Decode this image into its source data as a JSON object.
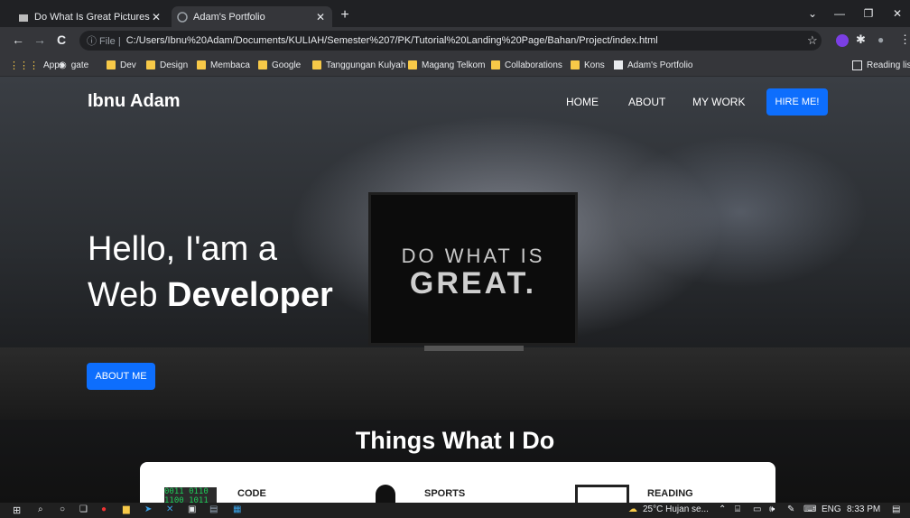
{
  "browser": {
    "tabs": [
      {
        "title": "Do What Is Great Pictures | Down",
        "active": false
      },
      {
        "title": "Adam's Portfolio",
        "active": true
      }
    ],
    "new_tab": "+",
    "window_controls": [
      "⌄",
      "—",
      "❐",
      "✕"
    ],
    "nav": {
      "back": "←",
      "forward": "→",
      "reload": "C"
    },
    "omnibox": {
      "security": "ⓘ File |",
      "url": "C:/Users/Ibnu%20Adam/Documents/KULIAH/Semester%207/PK/Tutorial%20Landing%20Page/Bahan/Project/index.html"
    },
    "bookmarks": [
      "Apps",
      "gate",
      "Dev",
      "Design",
      "Membaca",
      "Google",
      "Tanggungan Kulyah",
      "Magang Telkom",
      "Collaborations",
      "Kons",
      "Adam's Portfolio"
    ],
    "reading_list": "Reading list"
  },
  "site": {
    "brand": "Ibnu Adam",
    "nav": [
      "HOME",
      "ABOUT",
      "MY WORK"
    ],
    "cta": "HIRE ME!",
    "hero_line1": "Hello, I'am a",
    "hero_line2_prefix": "Web ",
    "hero_line2_bold": "Developer",
    "monitor_line1": "DO WHAT IS",
    "monitor_line2": "GREAT.",
    "about_button": "ABOUT ME",
    "section_title": "Things What I Do",
    "services": [
      "CODE",
      "SPORTS",
      "READING"
    ]
  },
  "taskbar": {
    "weather": "25°C  Hujan se...",
    "lang": "ENG",
    "time": "8:33 PM"
  },
  "colors": {
    "accent": "#0d6efd"
  }
}
